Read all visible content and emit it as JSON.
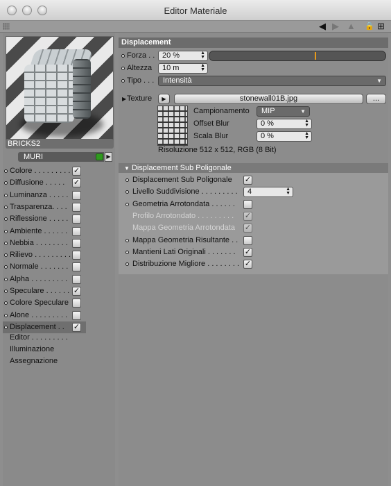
{
  "window": {
    "title": "Editor Materiale"
  },
  "toolbar": {
    "back_icon": "◀",
    "forward_icon": "▶",
    "up_icon": "▲",
    "lock_icon": "🔒",
    "new_icon": "⊞"
  },
  "material": {
    "name": "BRICKS2",
    "layer": "MURI",
    "layer_color": "#2f9a1e"
  },
  "channels": [
    {
      "label": "Colore . . . . . . . . .",
      "checked": "✓",
      "active": false
    },
    {
      "label": "Diffusione . . . . .",
      "checked": "✓",
      "active": false
    },
    {
      "label": "Luminanza . . . . .",
      "checked": "",
      "active": false
    },
    {
      "label": "Trasparenza. . . .",
      "checked": "",
      "active": false
    },
    {
      "label": "Riflessione . . . . .",
      "checked": "",
      "active": false
    },
    {
      "label": "Ambiente . . . . . .",
      "checked": "",
      "active": false
    },
    {
      "label": "Nebbia . . . . . . . .",
      "checked": "",
      "active": false
    },
    {
      "label": "Rilievo . . . . . . . . .",
      "checked": "",
      "active": false
    },
    {
      "label": "Normale . . . . . . .",
      "checked": "",
      "active": false
    },
    {
      "label": "Alpha . . . . . . . . .",
      "checked": "",
      "active": false
    },
    {
      "label": "Speculare . . . . . .",
      "checked": "✓",
      "active": false
    },
    {
      "label": "Colore Speculare",
      "checked": "",
      "active": false
    },
    {
      "label": "Alone . . . . . . . . .",
      "checked": "",
      "active": false
    },
    {
      "label": "Displacement . .",
      "checked": "✓",
      "active": true
    }
  ],
  "extra_items": [
    "Editor . . . . . . . . .",
    "Illuminazione",
    "Assegnazione"
  ],
  "displacement": {
    "section_title": "Displacement",
    "forza_label": "Forza . .",
    "forza_value": "20 %",
    "forza_slider": 0.6,
    "altezza_label": "Altezza",
    "altezza_value": "10 m",
    "tipo_label": "Tipo . . .",
    "tipo_value": "Intensità",
    "texture_label": "Texture",
    "texture_file": "stonewall01B.jpg",
    "texture_more": "...",
    "campionamento_label": "Campionamento",
    "campionamento_value": "MIP",
    "offset_blur_label": "Offset Blur",
    "offset_blur_value": "0 %",
    "scala_blur_label": "Scala Blur",
    "scala_blur_value": "0 %",
    "resolution": "Risoluzione 512 x 512, RGB (8 Bit)"
  },
  "sub_poly": {
    "section_title": "Displacement Sub Poligonale",
    "rows": [
      {
        "label": "Displacement Sub Poligonale",
        "checked": "✓",
        "dim": false,
        "dot": true
      },
      {
        "label": "Livello Suddivisione . . . . . . . . .",
        "checked": "",
        "dim": false,
        "dot": true,
        "field": "4"
      },
      {
        "label": "Geometria Arrotondata . . . . . .",
        "checked": "",
        "dim": false,
        "dot": true
      },
      {
        "label": "Profilo Arrotondato . . . . . . . . .",
        "checked": "✓",
        "dim": true,
        "dot": false
      },
      {
        "label": "Mappa Geometria Arrotondata",
        "checked": "✓",
        "dim": true,
        "dot": false
      },
      {
        "label": "Mappa Geometria Risultante . .",
        "checked": "",
        "dim": false,
        "dot": true
      },
      {
        "label": "Mantieni Lati Originali . . . . . . .",
        "checked": "✓",
        "dim": false,
        "dot": true
      },
      {
        "label": "Distribuzione Migliore . . . . . . . .",
        "checked": "✓",
        "dim": false,
        "dot": true
      }
    ]
  }
}
